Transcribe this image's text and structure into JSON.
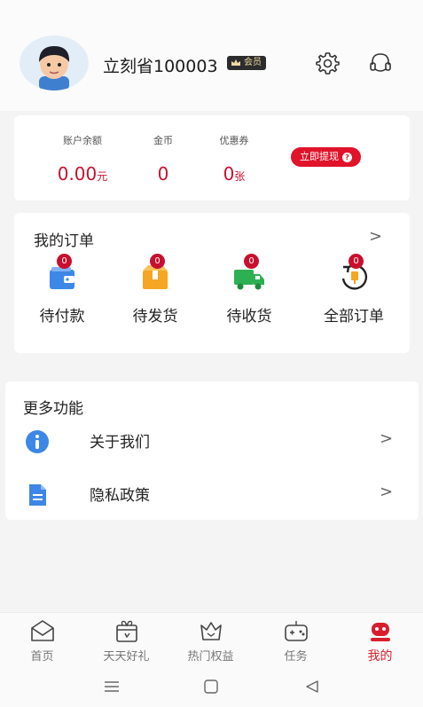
{
  "profile": {
    "username": "立刻省100003",
    "member_badge": "会员"
  },
  "balance": {
    "items": [
      {
        "label": "账户余额",
        "value": "0.00",
        "unit": "元"
      },
      {
        "label": "金币",
        "value": "0",
        "unit": ""
      },
      {
        "label": "优惠券",
        "value": "0",
        "unit": "张"
      }
    ],
    "withdraw_label": "立即提现",
    "withdraw_dot": "?"
  },
  "orders": {
    "title": "我的订单",
    "more": ">",
    "items": [
      {
        "label": "待付款",
        "count": "0",
        "icon": "wallet-icon"
      },
      {
        "label": "待发货",
        "count": "0",
        "icon": "box-icon"
      },
      {
        "label": "待收货",
        "count": "0",
        "icon": "truck-icon"
      },
      {
        "label": "全部订单",
        "count": "0",
        "icon": "refresh-icon"
      }
    ]
  },
  "more": {
    "title": "更多功能",
    "items": [
      {
        "label": "关于我们",
        "icon": "info-icon",
        "chevron": ">"
      },
      {
        "label": "隐私政策",
        "icon": "document-icon",
        "chevron": ">"
      }
    ]
  },
  "tabbar": {
    "items": [
      {
        "label": "首页",
        "icon": "home-envelope-icon",
        "active": false
      },
      {
        "label": "天天好礼",
        "icon": "gift-calendar-icon",
        "active": false
      },
      {
        "label": "热门权益",
        "icon": "crown-icon",
        "active": false
      },
      {
        "label": "任务",
        "icon": "gamepad-icon",
        "active": false
      },
      {
        "label": "我的",
        "icon": "robot-face-icon",
        "active": true
      }
    ]
  },
  "colors": {
    "accent": "#d81e2c",
    "value_red": "#c8102e",
    "blue": "#3d87e6",
    "orange": "#f5a623",
    "green": "#2db052"
  }
}
